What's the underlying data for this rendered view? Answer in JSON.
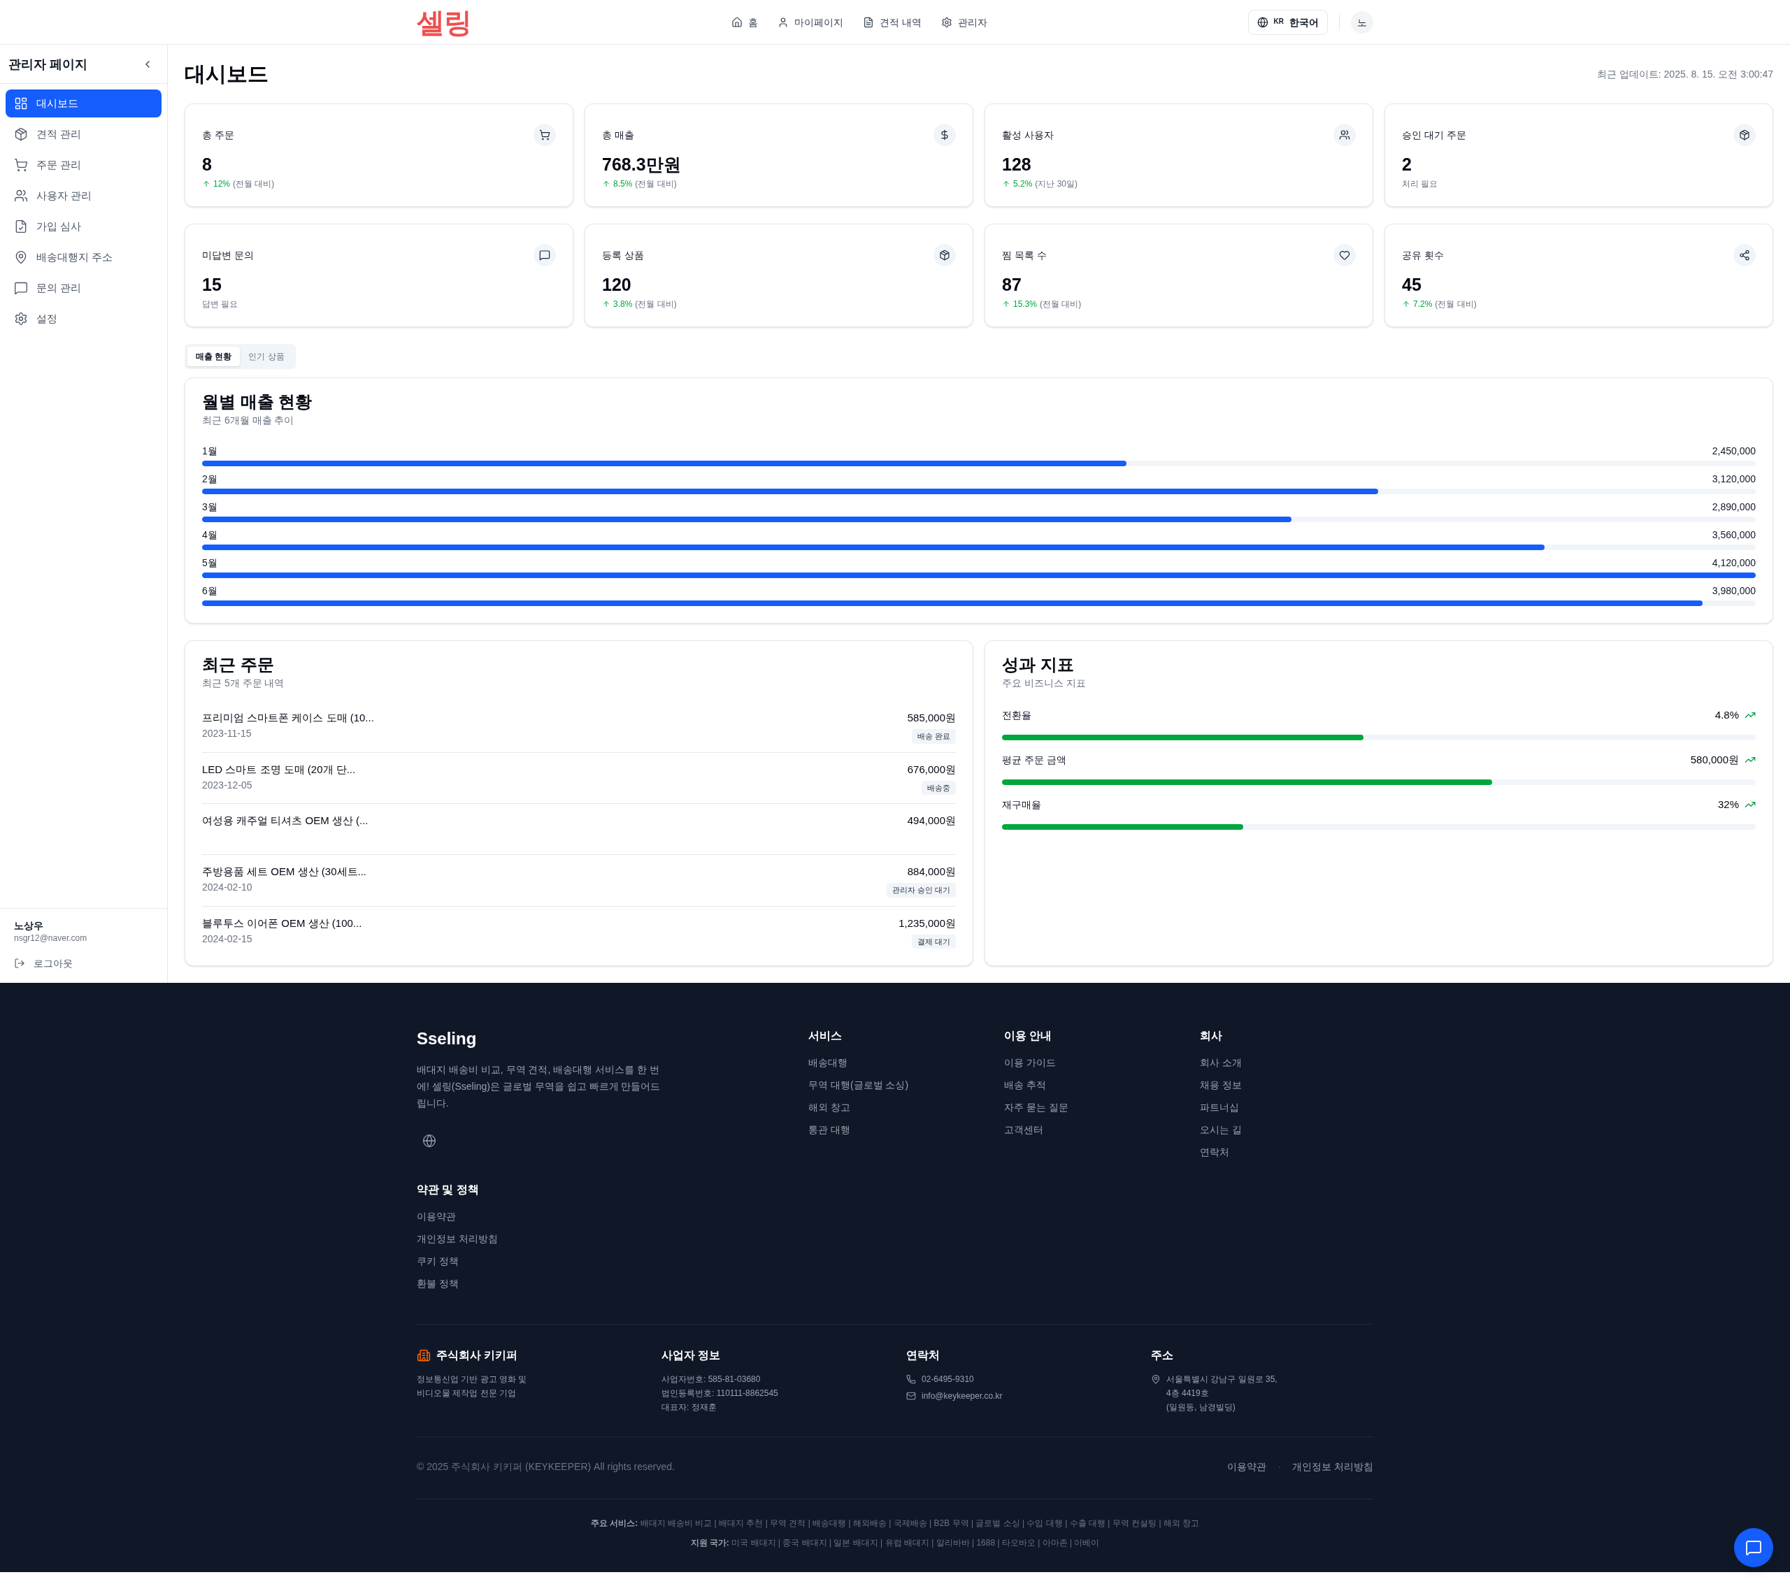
{
  "header": {
    "logo": "셀링",
    "nav": [
      {
        "label": "홈"
      },
      {
        "label": "마이페이지"
      },
      {
        "label": "견적 내역"
      },
      {
        "label": "관리자"
      }
    ],
    "language": {
      "code": "KR",
      "label": "한국어"
    },
    "avatar": "노"
  },
  "sidebar": {
    "title": "관리자 페이지",
    "items": [
      {
        "label": "대시보드",
        "selected": true
      },
      {
        "label": "견적 관리",
        "selected": false
      },
      {
        "label": "주문 관리",
        "selected": false
      },
      {
        "label": "사용자 관리",
        "selected": false
      },
      {
        "label": "가입 심사",
        "selected": false
      },
      {
        "label": "배송대행지 주소",
        "selected": false
      },
      {
        "label": "문의 관리",
        "selected": false
      },
      {
        "label": "설정",
        "selected": false
      }
    ],
    "user": {
      "name": "노상우",
      "email": "nsgr12@naver.com"
    },
    "logout": "로그아웃"
  },
  "page": {
    "title": "대시보드",
    "updated": "최근 업데이트: 2025. 8. 15. 오전 3:00:47"
  },
  "stats": [
    {
      "label": "총 주문",
      "value": "8",
      "change": "12%",
      "note": "(전월 대비)"
    },
    {
      "label": "총 매출",
      "value": "768.3만원",
      "change": "8.5%",
      "note": "(전월 대비)"
    },
    {
      "label": "활성 사용자",
      "value": "128",
      "change": "5.2%",
      "note": "(지난 30일)"
    },
    {
      "label": "승인 대기 주문",
      "value": "2",
      "note": "처리 필요"
    },
    {
      "label": "미답변 문의",
      "value": "15",
      "note": "답변 필요"
    },
    {
      "label": "등록 상품",
      "value": "120",
      "change": "3.8%",
      "note": "(전월 대비)"
    },
    {
      "label": "찜 목록 수",
      "value": "87",
      "change": "15.3%",
      "note": "(전월 대비)"
    },
    {
      "label": "공유 횟수",
      "value": "45",
      "change": "7.2%",
      "note": "(전월 대비)"
    }
  ],
  "tabs": [
    {
      "label": "매출 현황",
      "selected": true
    },
    {
      "label": "인기 상품",
      "selected": false
    }
  ],
  "monthly_sales": {
    "title": "월별 매출 현황",
    "subtitle": "최근 6개월 매출 추이",
    "rows": [
      {
        "label": "1월",
        "value": "2,450,000",
        "level": 0.595
      },
      {
        "label": "2월",
        "value": "3,120,000",
        "level": 0.757
      },
      {
        "label": "3월",
        "value": "2,890,000",
        "level": 0.701
      },
      {
        "label": "4월",
        "value": "3,560,000",
        "level": 0.864
      },
      {
        "label": "5월",
        "value": "4,120,000",
        "level": 1
      },
      {
        "label": "6월",
        "value": "3,980,000",
        "level": 0.966
      }
    ]
  },
  "recent_orders": {
    "title": "최근 주문",
    "subtitle": "최근 5개 주문 내역",
    "orders": [
      {
        "title": "프리미엄 스마트폰 케이스 도매 (10...",
        "date": "2023-11-15",
        "price": "585,000원",
        "status": "배송 완료"
      },
      {
        "title": "LED 스마트 조명 도매 (20개 단...",
        "date": "2023-12-05",
        "price": "676,000원",
        "status": "배송중"
      },
      {
        "title": "여성용 캐주얼 티셔츠 OEM 생산 (...",
        "price": "494,000원"
      },
      {
        "title": "주방용품 세트 OEM 생산 (30세트...",
        "date": "2024-02-10",
        "price": "884,000원",
        "status": "관리자 승인 대기"
      },
      {
        "title": "블루투스 이어폰 OEM 생산 (100...",
        "date": "2024-02-15",
        "price": "1,235,000원",
        "status": "결제 대기"
      }
    ]
  },
  "performance": {
    "title": "성과 지표",
    "subtitle": "주요 비즈니스 지표",
    "metrics": [
      {
        "label": "전환율",
        "value": "4.8%",
        "level": 0.48
      },
      {
        "label": "평균 주문 금액",
        "value": "580,000원",
        "level": 0.65
      },
      {
        "label": "재구매율",
        "value": "32%",
        "level": 0.32
      }
    ]
  },
  "footer": {
    "brand": "Sseling",
    "description": "배대지 배송비 비교, 무역 견적, 배송대행 서비스를 한 번에! 셀링(Sseling)은 글로벌 무역을 쉽고 빠르게 만들어드립니다.",
    "columns": [
      {
        "title": "서비스",
        "links": [
          "배송대행",
          "무역 대행(글로벌 소싱)",
          "해외 창고",
          "통관 대행"
        ]
      },
      {
        "title": "이용 안내",
        "links": [
          "이용 가이드",
          "배송 추적",
          "자주 묻는 질문",
          "고객센터"
        ]
      },
      {
        "title": "회사",
        "links": [
          "회사 소개",
          "채용 정보",
          "파트너십",
          "오시는 길",
          "연락처"
        ]
      },
      {
        "title": "약관 및 정책",
        "links": [
          "이용약관",
          "개인정보 처리방침",
          "쿠키 정책",
          "환불 정책"
        ]
      }
    ],
    "company": {
      "name": "주식회사 키키퍼",
      "description": "정보통신업 기반 광고 영화 및\n비디오물 제작업 전문 기업"
    },
    "business": {
      "title": "사업자 정보",
      "lines": [
        "사업자번호: 585-81-03680",
        "법인등록번호: 110111-8862545",
        "대표자: 정재훈"
      ]
    },
    "contact": {
      "title": "연락처",
      "phone": "02-6495-9310",
      "email": "info@keykeeper.co.kr"
    },
    "address": {
      "title": "주소",
      "text": "서울특별시 강남구 일원로 35,\n4층 4419호\n(일원동, 남경빌딩)"
    },
    "copyright": "© 2025 주식회사 키키퍼 (KEYKEEPER) All rights reserved.",
    "legal_links": [
      "이용약관",
      "개인정보 처리방침"
    ],
    "separator": "·",
    "service_lines": [
      "**주요 서비스:** 배대지 배송비 비교 | 배대지 추천 | 무역 견적 | 배송대행 | 해외배송 | 국제배송 | B2B 무역 | 글로벌 소싱 | 수입 대행 | 수출 대행 | 무역 컨설팅 | 해외 창고",
      "**지원 국가:** 미국 배대지 | 중국 배대지 | 일본 배대지 | 유럽 배대지 | 알리바바 | 1688 | 타오바오 | 아마존 | 이베이"
    ]
  }
}
